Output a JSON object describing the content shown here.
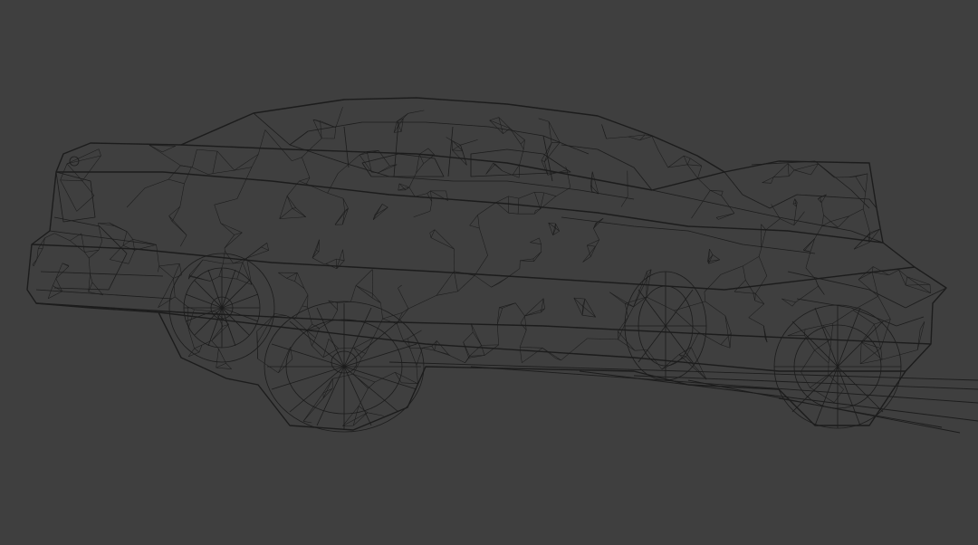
{
  "viewport": {
    "background_color": "#3f3f3f",
    "wire_color": "#1c1c1c",
    "render_mode": "wireframe",
    "subject": "car-model-icon"
  }
}
